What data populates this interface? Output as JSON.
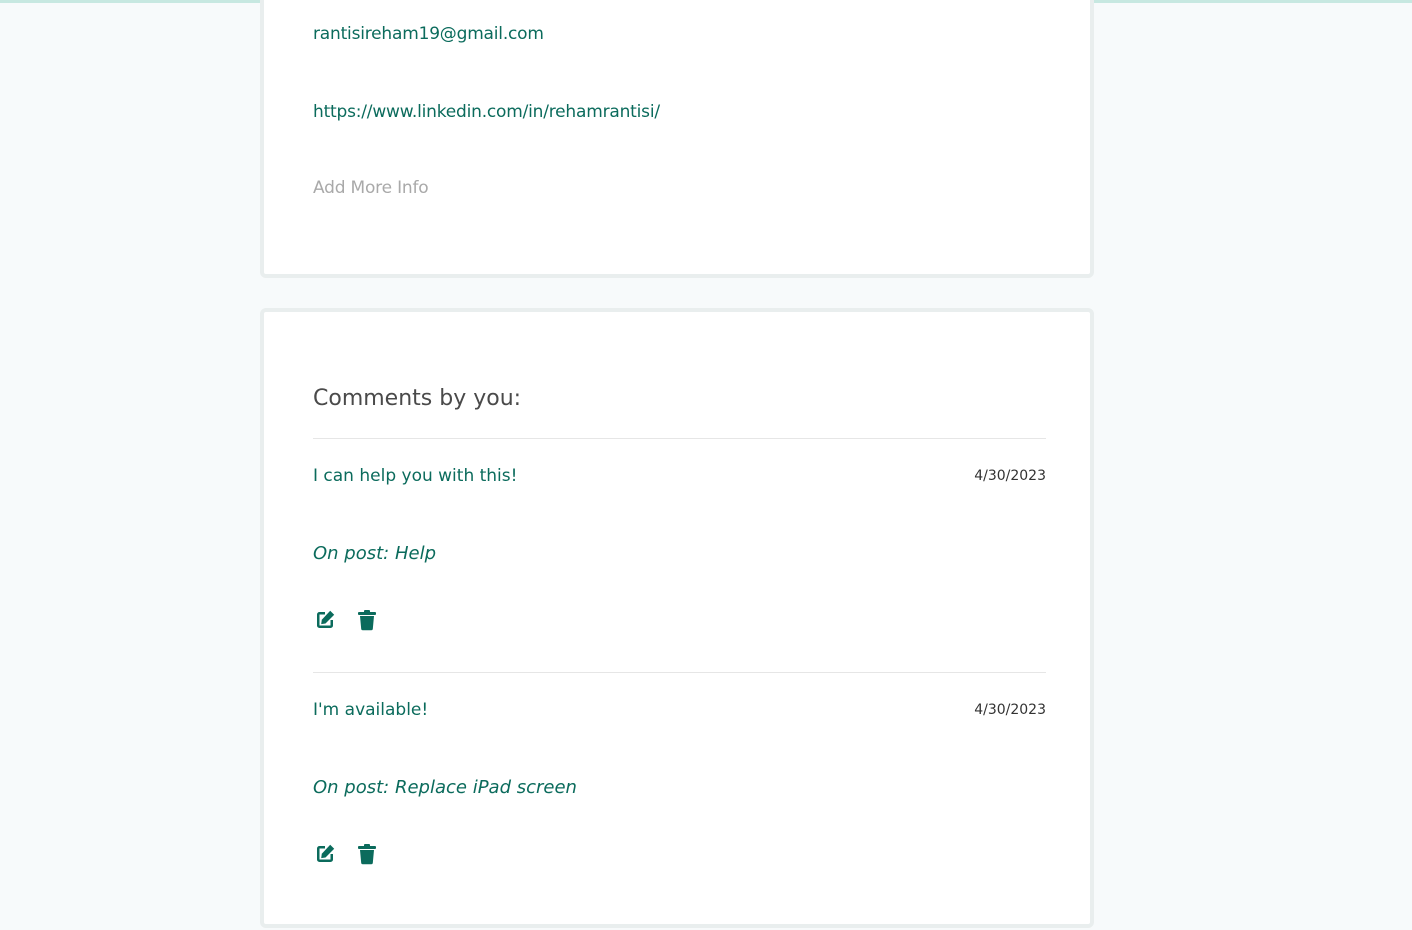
{
  "profile": {
    "email": "rantisireham19@gmail.com",
    "linkedin": "https://www.linkedin.com/in/rehamrantisi/",
    "add_more_info": "Add More Info"
  },
  "comments_section": {
    "title": "Comments by you:",
    "comments": [
      {
        "text": "I can help you with this!",
        "date": "4/30/2023",
        "post": "On post: Help",
        "edit_icon": "edit-icon",
        "delete_icon": "trash-icon"
      },
      {
        "text": "I'm available!",
        "date": "4/30/2023",
        "post": "On post: Replace iPad screen",
        "edit_icon": "edit-icon",
        "delete_icon": "trash-icon"
      }
    ]
  },
  "colors": {
    "accent": "#0b6b5c",
    "muted": "#a9a9a9",
    "heading": "#4a4a4a",
    "page_background": "#f7fafb",
    "top_bar": "#c7e8e1"
  }
}
